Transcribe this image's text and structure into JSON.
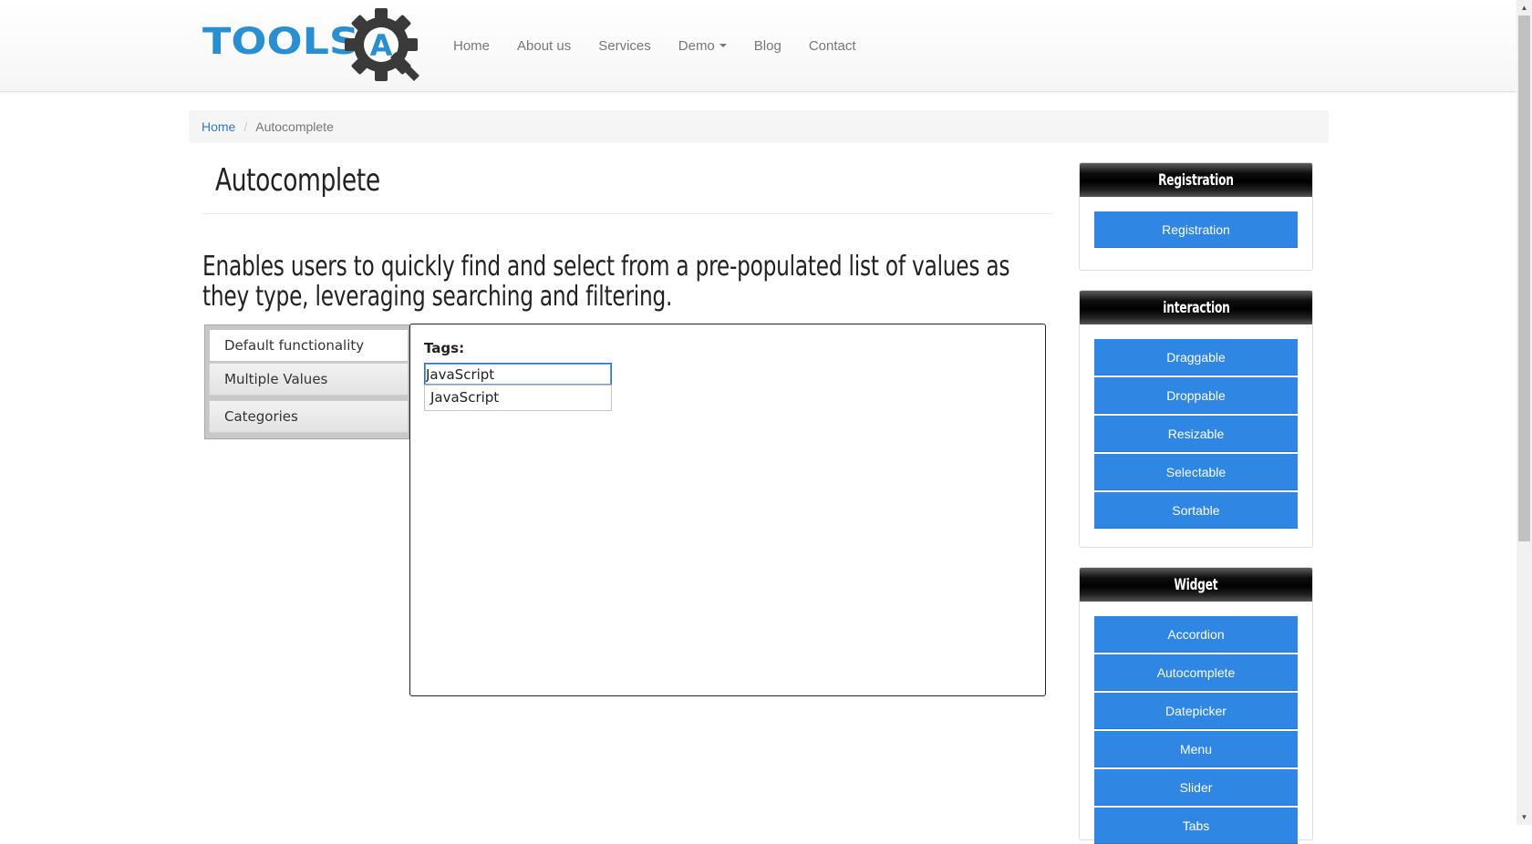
{
  "logo": {
    "text": "TOOLS",
    "mark_letter": "A"
  },
  "nav": {
    "items": [
      {
        "label": "Home"
      },
      {
        "label": "About us"
      },
      {
        "label": "Services"
      },
      {
        "label": "Demo"
      },
      {
        "label": "Blog"
      },
      {
        "label": "Contact"
      }
    ]
  },
  "breadcrumb": {
    "home": "Home",
    "separator": "/",
    "current": "Autocomplete"
  },
  "page": {
    "title": "Autocomplete",
    "lead": "Enables users to quickly find and select from a pre-populated list of values as they type, leveraging searching and filtering."
  },
  "demo": {
    "tabs": [
      {
        "label": "Default functionality",
        "active": true
      },
      {
        "label": "Multiple Values",
        "active": false
      },
      {
        "label": "Categories",
        "active": false
      }
    ],
    "tags_label": "Tags:",
    "input_value": "JavaScript",
    "suggestions": [
      "JavaScript"
    ]
  },
  "sidebar": {
    "registration": {
      "title": "Registration",
      "buttons": [
        "Registration"
      ]
    },
    "interaction": {
      "title": "interaction",
      "buttons": [
        "Draggable",
        "Droppable",
        "Resizable",
        "Selectable",
        "Sortable"
      ]
    },
    "widget": {
      "title": "Widget",
      "buttons": [
        "Accordion",
        "Autocomplete",
        "Datepicker",
        "Menu",
        "Slider",
        "Tabs"
      ]
    }
  },
  "colors": {
    "brand_blue": "#2a8fd0",
    "button_blue": "#2f86e3",
    "link_blue": "#337ab7",
    "widget_header": "#000000"
  }
}
